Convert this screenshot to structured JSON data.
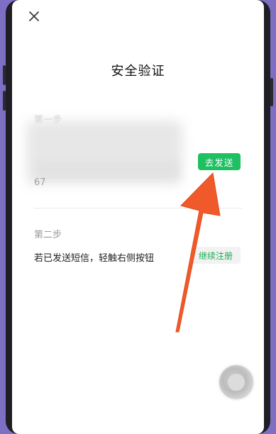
{
  "dialog": {
    "close_icon": "close-icon",
    "title": "安全验证"
  },
  "step1": {
    "label": "第一步",
    "masked_number": "67",
    "send_button": "去发送"
  },
  "step2": {
    "label": "第二步",
    "instruction": "若已发送短信，轻触右侧按钮",
    "continue_button": "继续注册"
  },
  "colors": {
    "send_button_bg": "#1ec062",
    "continue_text": "#1aad55",
    "arrow": "#f05a2a"
  }
}
